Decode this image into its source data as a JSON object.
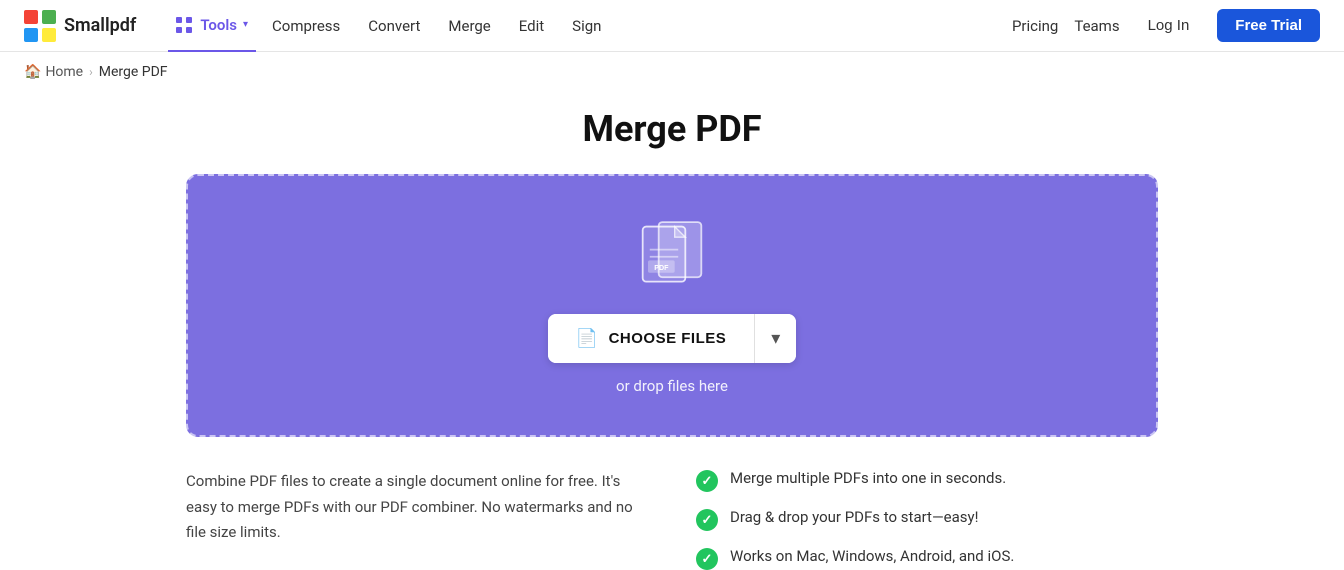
{
  "header": {
    "logo_text": "Smallpdf",
    "tools_label": "Tools",
    "nav_links": [
      {
        "label": "Compress",
        "name": "compress"
      },
      {
        "label": "Convert",
        "name": "convert"
      },
      {
        "label": "Merge",
        "name": "merge"
      },
      {
        "label": "Edit",
        "name": "edit"
      },
      {
        "label": "Sign",
        "name": "sign"
      }
    ],
    "right_links": [
      {
        "label": "Pricing",
        "name": "pricing"
      },
      {
        "label": "Teams",
        "name": "teams"
      }
    ],
    "login_label": "Log In",
    "free_trial_label": "Free Trial"
  },
  "breadcrumb": {
    "home_label": "Home",
    "separator": "›",
    "current": "Merge PDF"
  },
  "page": {
    "title": "Merge PDF"
  },
  "dropzone": {
    "choose_files_label": "CHOOSE FILES",
    "drop_text": "or drop files here"
  },
  "features": {
    "description": "Combine PDF files to create a single document online for free. It's easy to merge PDFs with our PDF combiner. No watermarks and no file size limits.",
    "items": [
      "Merge multiple PDFs into one in seconds.",
      "Drag & drop your PDFs to start—easy!",
      "Works on Mac, Windows, Android, and iOS."
    ]
  }
}
